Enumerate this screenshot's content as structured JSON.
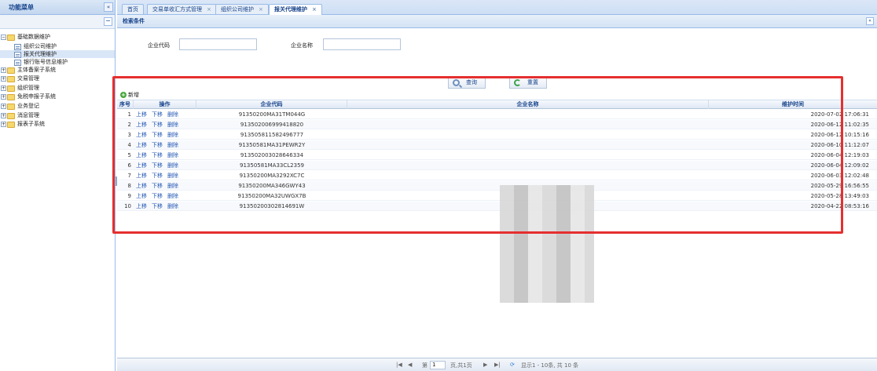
{
  "sidebar": {
    "title": "功能菜单",
    "collapse_icon": "«",
    "toolbar_icon": "−",
    "tree": [
      {
        "label": "基础数据维护",
        "expanded": true,
        "children": [
          {
            "label": "组织公司维护",
            "selected": false
          },
          {
            "label": "报关代理维护",
            "selected": true
          },
          {
            "label": "银行账号信息维护",
            "selected": false
          }
        ]
      },
      {
        "label": "主体备案子系统"
      },
      {
        "label": "交易管理"
      },
      {
        "label": "组织管理"
      },
      {
        "label": "免税申报子系统"
      },
      {
        "label": "业务登记"
      },
      {
        "label": "消息管理"
      },
      {
        "label": "报表子系统"
      }
    ]
  },
  "tabs": [
    {
      "label": "首页",
      "closable": false,
      "active": false
    },
    {
      "label": "交易单收汇方式管理",
      "closable": true,
      "active": false
    },
    {
      "label": "组织公司维护",
      "closable": true,
      "active": false
    },
    {
      "label": "报关代理维护",
      "closable": true,
      "active": true
    }
  ],
  "search": {
    "title": "检索条件",
    "collapse_icon": "«",
    "code_label": "企业代码",
    "name_label": "企业名称",
    "code_value": "",
    "name_value": "",
    "query_button": "查询",
    "reset_button": "重置"
  },
  "grid": {
    "add_label": "新增",
    "columns": [
      "序号",
      "操作",
      "企业代码",
      "企业名称",
      "维护时间"
    ],
    "op_labels": [
      "上移",
      "下移",
      "删除"
    ],
    "rows": [
      {
        "index": "1",
        "code": "91350200MA31TM044G",
        "time": "2020-07-02 17:06:31"
      },
      {
        "index": "2",
        "code": "913502006999418820",
        "time": "2020-06-12 11:02:35"
      },
      {
        "index": "3",
        "code": "913505811582496777",
        "time": "2020-06-12 10:15:16"
      },
      {
        "index": "4",
        "code": "91350581MA31PEWR2Y",
        "time": "2020-06-10 11:12:07"
      },
      {
        "index": "5",
        "code": "913502003028646334",
        "time": "2020-06-04 12:19:03"
      },
      {
        "index": "6",
        "code": "91350581MA33CL2359",
        "time": "2020-06-04 12:09:02"
      },
      {
        "index": "7",
        "code": "91350200MA3292XC7C",
        "time": "2020-06-03 12:02:48"
      },
      {
        "index": "8",
        "code": "91350200MA346GWY43",
        "time": "2020-05-29 16:56:55"
      },
      {
        "index": "9",
        "code": "91350200MA32UWGX7B",
        "time": "2020-05-28 13:49:03"
      },
      {
        "index": "10",
        "code": "91350200302814691W",
        "time": "2020-04-22 08:53:16"
      }
    ]
  },
  "pager": {
    "first": "|◀",
    "prev": "◀",
    "page_prefix": "第",
    "page_value": "1",
    "page_suffix": "页,共1页",
    "next": "▶",
    "last": "▶|",
    "refresh": "⟳",
    "summary": "显示1 - 10条, 共 10 条"
  },
  "colors": {
    "accent": "#15428b",
    "border": "#99bbe8",
    "highlight": "#e52f2f",
    "link": "#2358b5"
  }
}
